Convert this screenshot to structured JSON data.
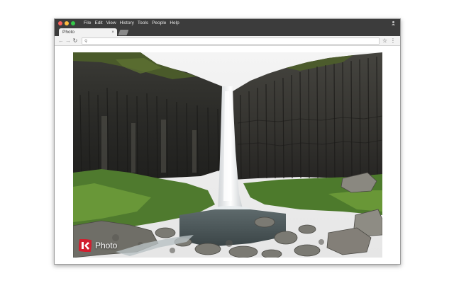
{
  "window": {
    "menu": [
      "File",
      "Edit",
      "View",
      "History",
      "Tools",
      "People",
      "Help"
    ]
  },
  "tabs": [
    {
      "title": "Photo",
      "close_glyph": "×"
    }
  ],
  "toolbar": {
    "back_glyph": "←",
    "forward_glyph": "→",
    "reload_glyph": "↻",
    "search_glyph": "⚲",
    "star_glyph": "☆",
    "menu_glyph": "⋮",
    "url_value": ""
  },
  "content": {
    "watermark_text": "Photo"
  },
  "colors": {
    "titlebar": "#3c3c3c",
    "tab": "#f2f2f2",
    "logo_red": "#d11f2f"
  },
  "icons": [
    "close-icon",
    "back-arrow-icon",
    "forward-arrow-icon",
    "reload-icon",
    "search-icon",
    "star-icon",
    "menu-icon",
    "profile-icon",
    "photo-logo-icon"
  ]
}
